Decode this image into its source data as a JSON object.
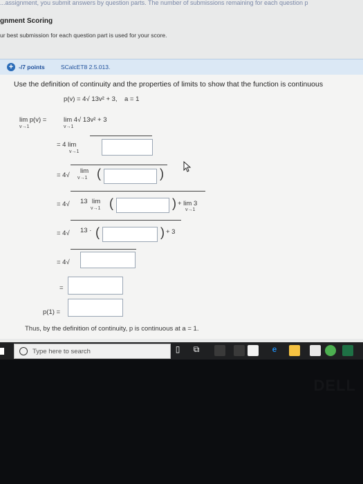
{
  "header": {
    "cut_text": "...assignment, you submit answers by question parts. The number of submissions remaining for each question p",
    "title": "gnment Scoring",
    "note": "ur best submission for each question part is used for your score."
  },
  "question": {
    "points": "-/7 points",
    "source": "SCalcET8 2.5.013.",
    "prompt": "Use the definition of continuity and the properties of limits to show that the function is continuous",
    "func_def": "p(v) = 4√ 13v² + 3,",
    "a_value": "a = 1",
    "line1_left": "lim  p(v)  =",
    "line1_right": "lim  4√ 13v² + 3",
    "v1": "v→1",
    "line2": "= 4 lim",
    "line3_prefix": "= 4√",
    "line3_lim": "lim",
    "line4_prefix": "= 4√",
    "line4_13": "13",
    "line4_lim": "lim",
    "line4_plus": "+ lim  3",
    "line5_prefix": "= 4√",
    "line5_13": "13 ·",
    "line5_plus": "+ 3",
    "line6_prefix": "= 4√",
    "line7_prefix": "=",
    "p1_label": "p(1)  =",
    "conclusion": "Thus, by the definition of continuity, p is continuous at  a = 1."
  },
  "taskbar": {
    "search_placeholder": "Type here to search",
    "icons": [
      "task-view-icon",
      "store-icon",
      "amazon-icon",
      "edge-icon",
      "file-explorer-icon",
      "chrome-icon",
      "excel-icon"
    ]
  },
  "colors": {
    "accent": "#2b6cb8",
    "header_bg": "#dbe8f5",
    "taskbar": "#1f2022"
  }
}
